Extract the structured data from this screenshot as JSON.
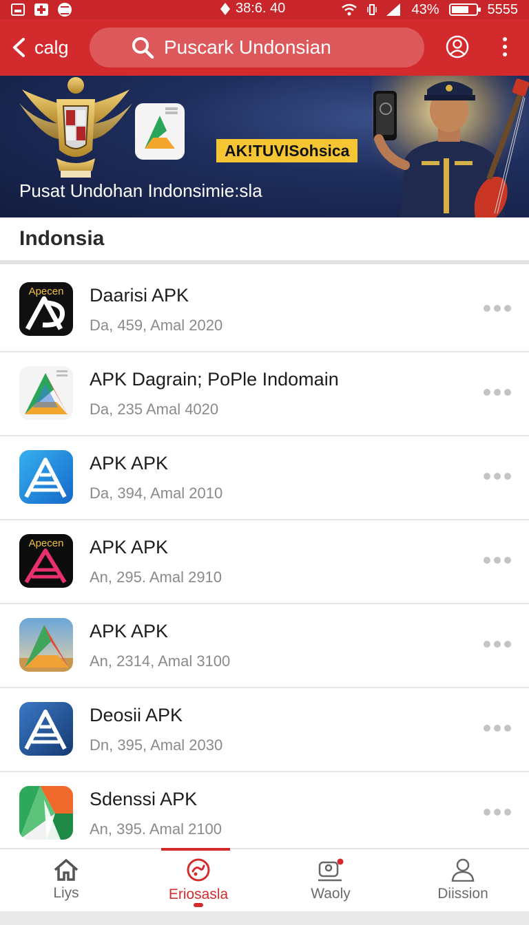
{
  "status_bar": {
    "time": "38:6. 40",
    "battery": "43%",
    "extra": "5555"
  },
  "app_bar": {
    "back_label": "calg",
    "search_text": "Puscark Undonsian"
  },
  "banner": {
    "tag": "AK!TUVISohsica",
    "title": "Pusat Undohan Indonsimie:sla"
  },
  "section": {
    "title": "Indonsia"
  },
  "apps": [
    {
      "name": "Daarisi APK",
      "meta": "Da, 459,  Amal 2020",
      "icon": "black-a-icon",
      "icon_text": "Apecen"
    },
    {
      "name": "APK Dagrain; PoPle Indomain",
      "meta": "Da, 235   Amal 4020",
      "icon": "color-triangle-icon"
    },
    {
      "name": "APK APK",
      "meta": "Da, 394, Amal 2010",
      "icon": "blue-a-icon"
    },
    {
      "name": "APK APK",
      "meta": "An, 295. Amal 2910",
      "icon": "black-pink-a-icon",
      "icon_text": "Apecen"
    },
    {
      "name": "APK APK",
      "meta": "An, 2314, Amal 3100",
      "icon": "landscape-a-icon"
    },
    {
      "name": "Deosii APK",
      "meta": "Dn, 395,  Amal 2030",
      "icon": "navy-a-icon"
    },
    {
      "name": "Sdenssi APK",
      "meta": "An, 395. Amal 2100",
      "icon": "green-orange-icon"
    }
  ],
  "bottom_nav": [
    {
      "label": "Liys",
      "icon": "home-icon",
      "active": false
    },
    {
      "label": "Eriosasla",
      "icon": "discover-icon",
      "active": true
    },
    {
      "label": "Waoly",
      "icon": "chat-icon",
      "active": false
    },
    {
      "label": "Diission",
      "icon": "profile-icon",
      "active": false
    }
  ],
  "colors": {
    "brand_red": "#d32a2e",
    "status_red": "#c8262a",
    "banner_navy": "#1e2d5c",
    "tag_yellow": "#f5c533"
  }
}
